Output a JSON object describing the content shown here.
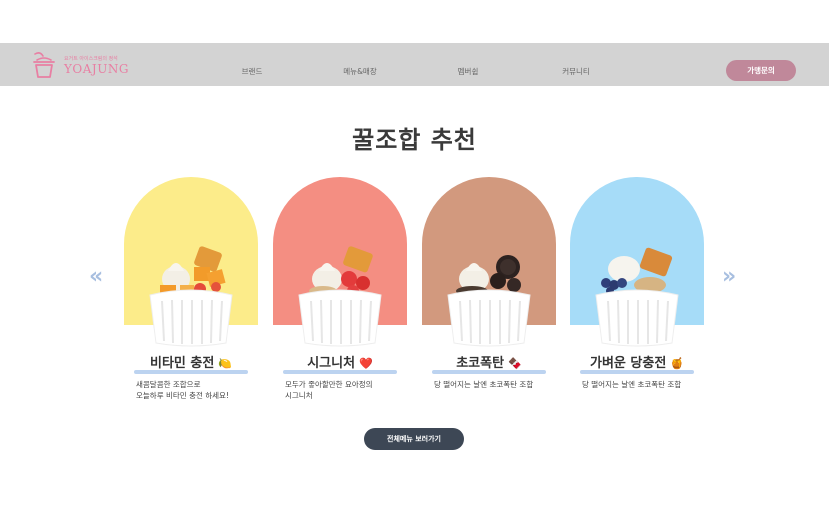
{
  "header": {
    "logo": {
      "tagline": "요거트 아이스크림의 정석",
      "name": "YOAJUNG"
    },
    "nav": [
      {
        "label": "브랜드"
      },
      {
        "label": "메뉴&매장"
      },
      {
        "label": "멤버쉽"
      },
      {
        "label": "커뮤니티"
      }
    ],
    "franchise_button": "가맹문의"
  },
  "section": {
    "title": "꿀조합 추천",
    "prev_arrow": "«",
    "next_arrow": "»"
  },
  "cards": [
    {
      "title": "비타민 충전",
      "emoji": "🍋",
      "desc": [
        "새콤달콤한 조합으로",
        "오늘하루 비타민 충전 하세요!"
      ],
      "bg": "#fcec8a"
    },
    {
      "title": "시그니처",
      "emoji": "❤️",
      "desc": [
        "모두가 좋아할만한 요아정의",
        "시그니처"
      ],
      "bg": "#f48e82"
    },
    {
      "title": "초코폭탄",
      "emoji": "🍫",
      "desc": [
        "당 떨어지는 날엔 초코폭탄 조합"
      ],
      "bg": "#d2997e"
    },
    {
      "title": "가벼운 당충전",
      "emoji": "🍯",
      "desc": [
        "당 떨어지는 날엔 초코폭탄 조합"
      ],
      "bg": "#a6dcf8"
    }
  ],
  "cta": {
    "label": "전체메뉴 보러가기"
  },
  "colors": {
    "brand_pink": "#e87fa3",
    "nav_bg": "#d3d3d3",
    "button_pink": "#c0889a",
    "button_dark": "#3d4755",
    "accent_blue": "#bcd3f0"
  }
}
